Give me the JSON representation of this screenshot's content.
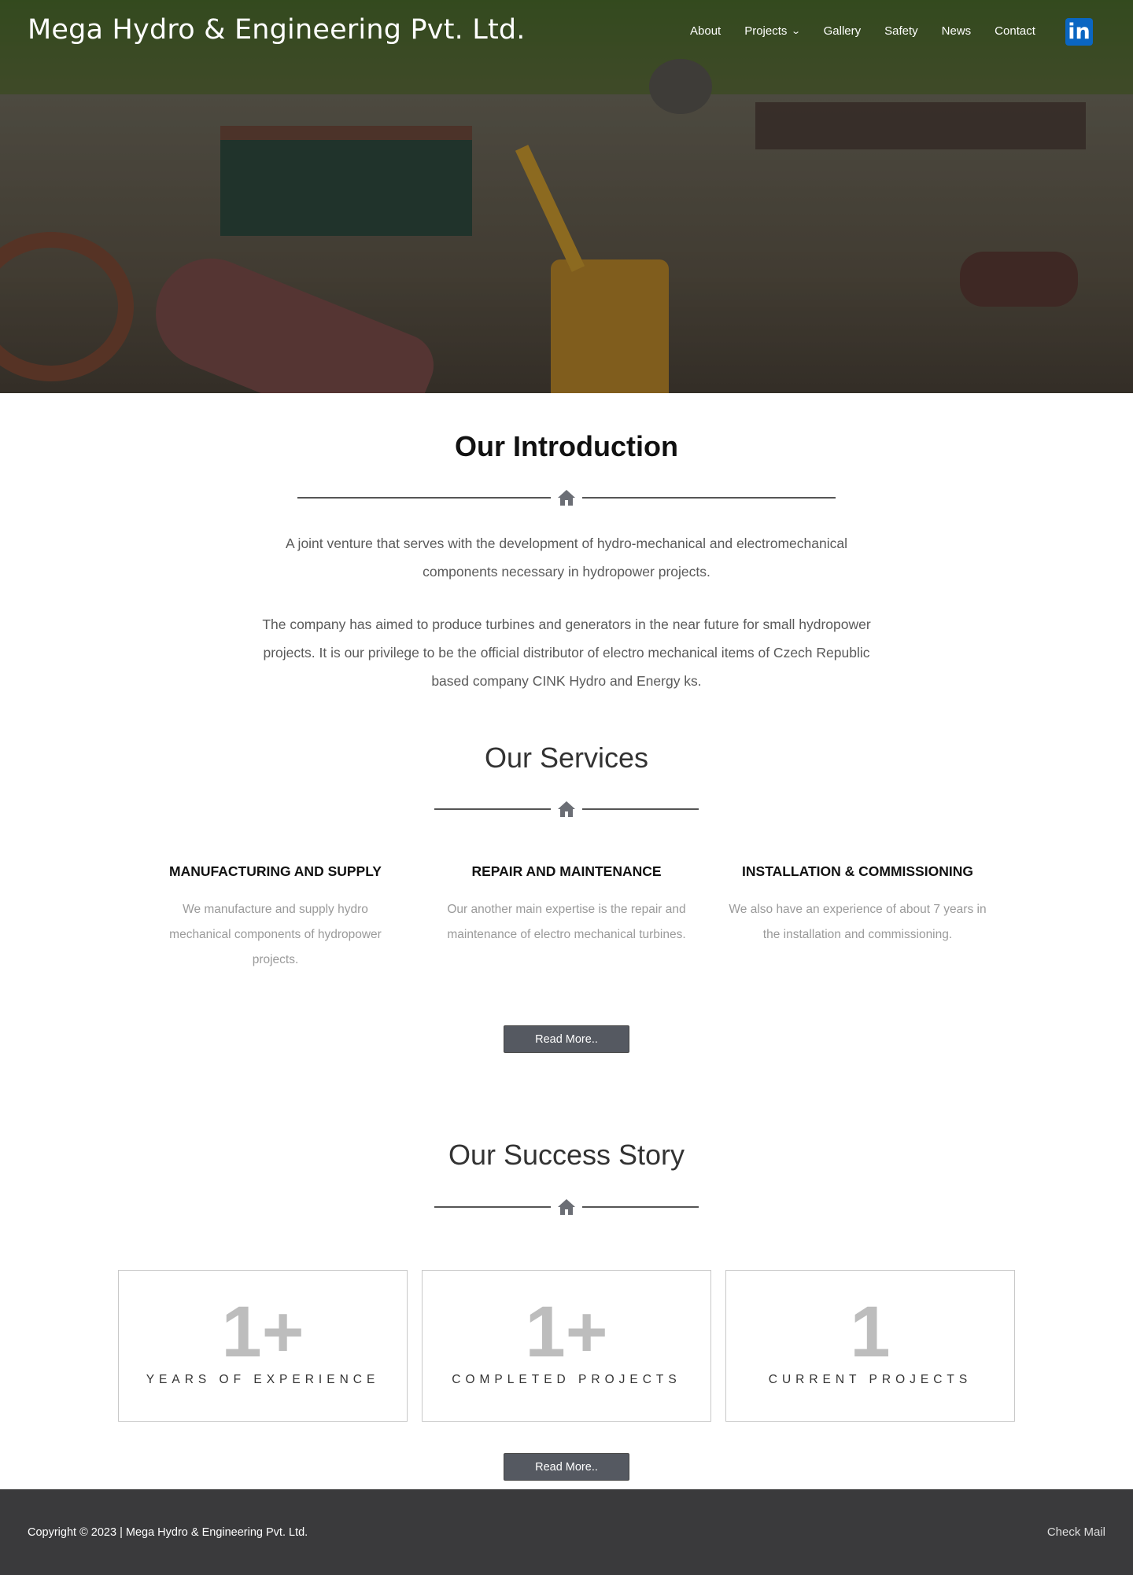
{
  "header": {
    "brand": "Mega Hydro & Engineering Pvt. Ltd.",
    "nav": [
      {
        "label": "About"
      },
      {
        "label": "Projects",
        "has_dropdown": true
      },
      {
        "label": "Gallery"
      },
      {
        "label": "Safety"
      },
      {
        "label": "News"
      },
      {
        "label": "Contact"
      }
    ],
    "linkedin_label": "in",
    "linkedin_icon": "linkedin-icon"
  },
  "intro": {
    "title": "Our Introduction",
    "paragraph1": "A joint venture that serves with the development of hydro-mechanical and electromechanical components necessary in hydropower projects.",
    "paragraph2": "The company has aimed to produce turbines and generators in the near future for small hydropower projects. It is our privilege to be the official distributor of electro mechanical items of Czech Republic based company CINK Hydro and Energy ks."
  },
  "services": {
    "title": "Our Services",
    "items": [
      {
        "heading": "MANUFACTURING AND SUPPLY",
        "text": "We manufacture and supply hydro mechanical components of hydropower projects."
      },
      {
        "heading": "REPAIR AND MAINTENANCE",
        "text": "Our another main expertise is the repair and maintenance of electro mechanical turbines."
      },
      {
        "heading": "INSTALLATION & COMMISSIONING",
        "text": "We also have an experience of about 7 years in the installation and commissioning."
      }
    ],
    "button": "Read More.."
  },
  "success": {
    "title": "Our Success Story",
    "stats": [
      {
        "value": "1+",
        "label": "YEARS OF EXPERIENCE"
      },
      {
        "value": "1+",
        "label": "COMPLETED PROJECTS"
      },
      {
        "value": "1",
        "label": "CURRENT PROJECTS"
      }
    ],
    "button": "Read More.."
  },
  "footer": {
    "copyright": "Copyright © 2023 | Mega Hydro & Engineering Pvt. Ltd.",
    "check_mail": "Check Mail"
  },
  "colors": {
    "footer_bg": "#3a3a3c",
    "button_bg": "#555961",
    "linkedin": "#0a66c2",
    "stat_number": "#bdbdbd"
  }
}
